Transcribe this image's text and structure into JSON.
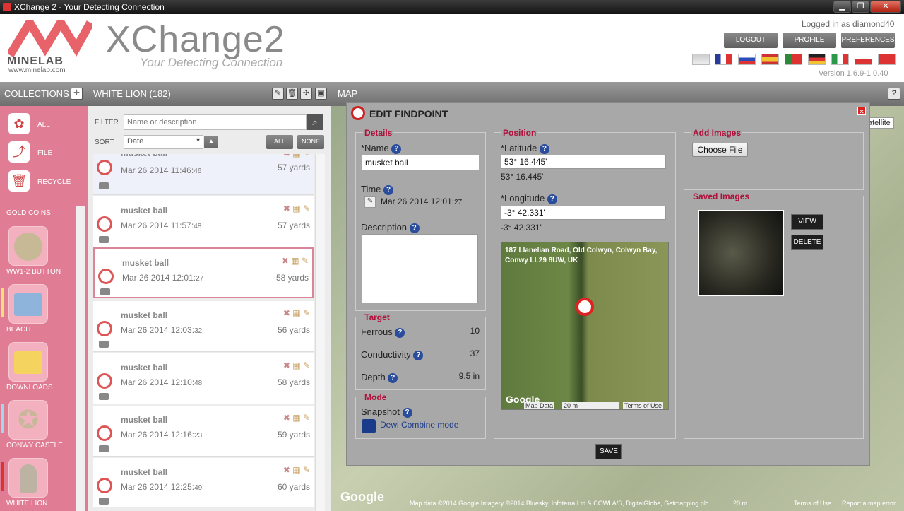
{
  "window": {
    "title": "XChange 2 - Your Detecting Connection"
  },
  "header": {
    "logo_brand": "MINELAB",
    "logo_url": "www.minelab.com",
    "app_name": "XChange2",
    "tagline": "Your Detecting Connection",
    "logged_in": "Logged in as diamond40",
    "buttons": {
      "logout": "LOGOUT",
      "profile": "PROFILE",
      "preferences": "PREFERENCES"
    },
    "version": "Version 1.6.9-1.0.40"
  },
  "toolbar": {
    "collections": "COLLECTIONS",
    "collection_name": "WHITE LION (182)",
    "map": "MAP",
    "help": "?"
  },
  "sidebar": {
    "all": "ALL",
    "file": "FILE",
    "recycle": "RECYCLE",
    "collections": [
      {
        "label": "GOLD COINS"
      },
      {
        "label": "WW1-2 BUTTON"
      },
      {
        "label": "BEACH"
      },
      {
        "label": "DOWNLOADS"
      },
      {
        "label": "CONWY CASTLE"
      },
      {
        "label": "WHITE LION"
      }
    ]
  },
  "list": {
    "filter_label": "FILTER",
    "filter_placeholder": "Name or description",
    "sort_label": "SORT",
    "sort_value": "Date",
    "all_btn": "ALL",
    "none_btn": "NONE",
    "rows": [
      {
        "name": "musket ball",
        "date": "Mar 26 2014 11:46:",
        "sec": "46",
        "yards": "57 yards"
      },
      {
        "name": "musket ball",
        "date": "Mar 26 2014 11:57:",
        "sec": "48",
        "yards": "57 yards"
      },
      {
        "name": "musket ball",
        "date": "Mar 26 2014 12:01:",
        "sec": "27",
        "yards": "58 yards"
      },
      {
        "name": "musket ball",
        "date": "Mar 26 2014 12:03:",
        "sec": "32",
        "yards": "56 yards"
      },
      {
        "name": "musket ball",
        "date": "Mar 26 2014 12:10:",
        "sec": "48",
        "yards": "58 yards"
      },
      {
        "name": "musket ball",
        "date": "Mar 26 2014 12:16:",
        "sec": "23",
        "yards": "59 yards"
      },
      {
        "name": "musket ball",
        "date": "Mar 26 2014 12:25:",
        "sec": "49",
        "yards": "60 yards"
      }
    ]
  },
  "dialog": {
    "title": "EDIT FINDPOINT",
    "details": {
      "title": "Details",
      "name_label": "*Name",
      "name_value": "musket ball",
      "time_label": "Time",
      "time_value": "Mar 26 2014 12:01:",
      "time_sec": "27",
      "desc_label": "Description"
    },
    "target": {
      "title": "Target",
      "ferrous_label": "Ferrous",
      "ferrous": "10",
      "cond_label": "Conductivity",
      "cond": "37",
      "depth_label": "Depth",
      "depth": "9.5 in"
    },
    "mode": {
      "title": "Mode",
      "snapshot_label": "Snapshot",
      "mode_value": "Dewi Combine mode"
    },
    "position": {
      "title": "Position",
      "lat_label": "*Latitude",
      "lat_value": "53° 16.445'",
      "lat_display": "53° 16.445'",
      "lon_label": "*Longitude",
      "lon_value": "-3° 42.331'",
      "lon_display": "-3° 42.331'",
      "address": "187 Llanelian Road, Old Colwyn, Colwyn Bay, Conwy LL29 8UW, UK",
      "map_data": "Map Data",
      "scale": "20 m",
      "terms": "Terms of Use",
      "google": "Google"
    },
    "add_images": {
      "title": "Add Images",
      "choose": "Choose File"
    },
    "saved_images": {
      "title": "Saved Images",
      "view": "VIEW",
      "delete": "DELETE"
    },
    "save": "SAVE"
  },
  "map": {
    "satellite": "atellite",
    "footer": "Map data ©2014 Google Imagery ©2014 Bluesky, Infoterra Ltd & COWI A/S, DigitalGlobe, Getmapping plc",
    "scale": "20 m",
    "terms": "Terms of Use",
    "report": "Report a map error",
    "google": "Google"
  }
}
